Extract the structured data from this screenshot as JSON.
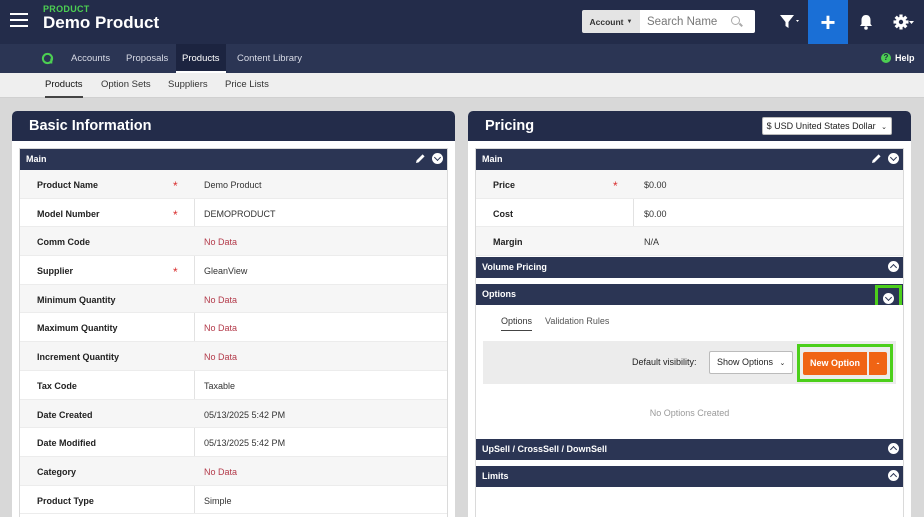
{
  "header": {
    "breadcrumb": "PRODUCT",
    "title": "Demo Product",
    "account_label": "Account",
    "search_placeholder": "Search Name"
  },
  "nav": {
    "items": [
      {
        "label": "Accounts"
      },
      {
        "label": "Proposals"
      },
      {
        "label": "Products"
      },
      {
        "label": "Content Library"
      }
    ],
    "help": "Help"
  },
  "subnav": {
    "items": [
      {
        "label": "Products"
      },
      {
        "label": "Option Sets"
      },
      {
        "label": "Suppliers"
      },
      {
        "label": "Price Lists"
      }
    ]
  },
  "basic": {
    "title": "Basic Information",
    "section": "Main",
    "rows": [
      {
        "label": "Product Name",
        "value": "Demo Product"
      },
      {
        "label": "Model Number",
        "value": "DEMOPRODUCT"
      },
      {
        "label": "Comm Code",
        "value": "No Data"
      },
      {
        "label": "Supplier",
        "value": "GleanView"
      },
      {
        "label": "Minimum Quantity",
        "value": "No Data"
      },
      {
        "label": "Maximum Quantity",
        "value": "No Data"
      },
      {
        "label": "Increment Quantity",
        "value": "No Data"
      },
      {
        "label": "Tax Code",
        "value": "Taxable"
      },
      {
        "label": "Date Created",
        "value": "05/13/2025 5:42 PM"
      },
      {
        "label": "Date Modified",
        "value": "05/13/2025 5:42 PM"
      },
      {
        "label": "Category",
        "value": "No Data"
      },
      {
        "label": "Product Type",
        "value": "Simple"
      }
    ]
  },
  "pricing": {
    "title": "Pricing",
    "currency": "$ USD United States Dollar",
    "main_section": "Main",
    "rows": [
      {
        "label": "Price",
        "value": "$0.00"
      },
      {
        "label": "Cost",
        "value": "$0.00"
      },
      {
        "label": "Margin",
        "value": "N/A"
      }
    ],
    "volume_pricing": "Volume Pricing",
    "options_section": "Options",
    "tabs": [
      {
        "label": "Options"
      },
      {
        "label": "Validation Rules"
      }
    ],
    "default_visibility_label": "Default visibility:",
    "default_visibility_value": "Show Options",
    "new_option_label": "New Option",
    "new_option_caret": "-",
    "empty_text": "No Options Created",
    "upsell_section": "UpSell / CrossSell / DownSell",
    "limits_section": "Limits"
  },
  "icons": {
    "required_mark": "*",
    "plus": "+"
  },
  "colors": {
    "topbar": "#232c4a",
    "accent_green": "#4ccf52",
    "primary_blue": "#1a6fd6",
    "orange": "#f06414",
    "no_data": "#b33a4a"
  }
}
